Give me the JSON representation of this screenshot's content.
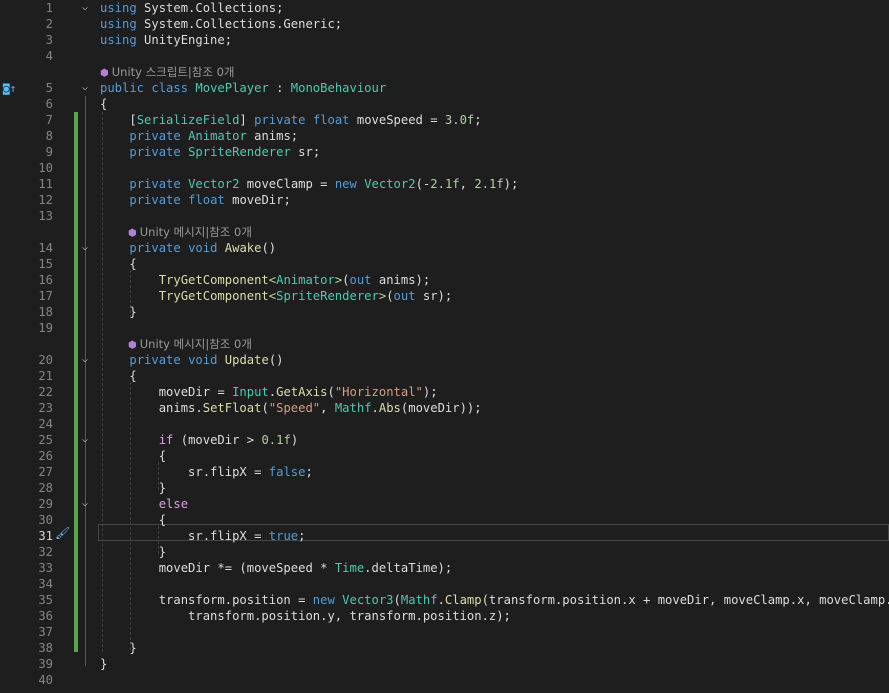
{
  "editor": {
    "lines": [
      {
        "n": "1",
        "fold": "v",
        "tokens": [
          [
            "kw",
            "using"
          ],
          [
            "pl",
            " System.Collections;"
          ]
        ]
      },
      {
        "n": "2",
        "tokens": [
          [
            "kw",
            "using"
          ],
          [
            "pl",
            " System.Collections.Generic;"
          ]
        ]
      },
      {
        "n": "3",
        "tokens": [
          [
            "kw",
            "using"
          ],
          [
            "pl",
            " UnityEngine;"
          ]
        ]
      },
      {
        "n": "4",
        "tokens": []
      },
      {
        "lens": "Unity 스크립트|참조 0개"
      },
      {
        "n": "5",
        "fold": "v",
        "tokens": [
          [
            "kw",
            "public"
          ],
          [
            "pl",
            " "
          ],
          [
            "kw",
            "class"
          ],
          [
            "pl",
            " "
          ],
          [
            "ty",
            "MovePlayer"
          ],
          [
            "pl",
            " : "
          ],
          [
            "ty",
            "MonoBehaviour"
          ]
        ]
      },
      {
        "n": "6",
        "tokens": [
          [
            "pl",
            "{"
          ]
        ]
      },
      {
        "n": "7",
        "tokens": [
          [
            "pl",
            "    ["
          ],
          [
            "ty",
            "SerializeField"
          ],
          [
            "pl",
            "] "
          ],
          [
            "kw",
            "private"
          ],
          [
            "pl",
            " "
          ],
          [
            "kw",
            "float"
          ],
          [
            "pl",
            " moveSpeed = "
          ],
          [
            "nm",
            "3.0f"
          ],
          [
            "pl",
            ";"
          ]
        ]
      },
      {
        "n": "8",
        "tokens": [
          [
            "pl",
            "    "
          ],
          [
            "kw",
            "private"
          ],
          [
            "pl",
            " "
          ],
          [
            "ty",
            "Animator"
          ],
          [
            "pl",
            " anims;"
          ]
        ]
      },
      {
        "n": "9",
        "tokens": [
          [
            "pl",
            "    "
          ],
          [
            "kw",
            "private"
          ],
          [
            "pl",
            " "
          ],
          [
            "ty",
            "SpriteRenderer"
          ],
          [
            "pl",
            " sr;"
          ]
        ]
      },
      {
        "n": "10",
        "tokens": []
      },
      {
        "n": "11",
        "tokens": [
          [
            "pl",
            "    "
          ],
          [
            "kw",
            "private"
          ],
          [
            "pl",
            " "
          ],
          [
            "ty",
            "Vector2"
          ],
          [
            "pl",
            " moveClamp = "
          ],
          [
            "kw",
            "new"
          ],
          [
            "pl",
            " "
          ],
          [
            "ty",
            "Vector2"
          ],
          [
            "pl",
            "(-"
          ],
          [
            "nm",
            "2.1f"
          ],
          [
            "pl",
            ", "
          ],
          [
            "nm",
            "2.1f"
          ],
          [
            "pl",
            ");"
          ]
        ]
      },
      {
        "n": "12",
        "tokens": [
          [
            "pl",
            "    "
          ],
          [
            "kw",
            "private"
          ],
          [
            "pl",
            " "
          ],
          [
            "kw",
            "float"
          ],
          [
            "pl",
            " moveDir;"
          ]
        ]
      },
      {
        "n": "13",
        "tokens": []
      },
      {
        "lens": "Unity 메시지|참조 0개",
        "indent": "    "
      },
      {
        "n": "14",
        "fold": "v",
        "tokens": [
          [
            "pl",
            "    "
          ],
          [
            "kw",
            "private"
          ],
          [
            "pl",
            " "
          ],
          [
            "kw",
            "void"
          ],
          [
            "pl",
            " "
          ],
          [
            "fn",
            "Awake"
          ],
          [
            "pl",
            "()"
          ]
        ]
      },
      {
        "n": "15",
        "tokens": [
          [
            "pl",
            "    {"
          ]
        ]
      },
      {
        "n": "16",
        "tokens": [
          [
            "pl",
            "        "
          ],
          [
            "fn",
            "TryGetComponent"
          ],
          [
            "gp",
            "<"
          ],
          [
            "ty",
            "Animator"
          ],
          [
            "gp",
            ">"
          ],
          [
            "pl",
            "("
          ],
          [
            "kw",
            "out"
          ],
          [
            "pl",
            " anims);"
          ]
        ]
      },
      {
        "n": "17",
        "tokens": [
          [
            "pl",
            "        "
          ],
          [
            "fn",
            "TryGetComponent"
          ],
          [
            "gp",
            "<"
          ],
          [
            "ty",
            "SpriteRenderer"
          ],
          [
            "gp",
            ">"
          ],
          [
            "pl",
            "("
          ],
          [
            "kw",
            "out"
          ],
          [
            "pl",
            " sr);"
          ]
        ]
      },
      {
        "n": "18",
        "tokens": [
          [
            "pl",
            "    }"
          ]
        ]
      },
      {
        "n": "19",
        "tokens": []
      },
      {
        "lens": "Unity 메시지|참조 0개",
        "indent": "    "
      },
      {
        "n": "20",
        "fold": "v",
        "tokens": [
          [
            "pl",
            "    "
          ],
          [
            "kw",
            "private"
          ],
          [
            "pl",
            " "
          ],
          [
            "kw",
            "void"
          ],
          [
            "pl",
            " "
          ],
          [
            "fn",
            "Update"
          ],
          [
            "pl",
            "()"
          ]
        ]
      },
      {
        "n": "21",
        "tokens": [
          [
            "pl",
            "    {"
          ]
        ]
      },
      {
        "n": "22",
        "tokens": [
          [
            "pl",
            "        moveDir = "
          ],
          [
            "ty",
            "Input"
          ],
          [
            "pl",
            "."
          ],
          [
            "fn",
            "GetAxis"
          ],
          [
            "pl",
            "("
          ],
          [
            "st",
            "\"Horizontal\""
          ],
          [
            "pl",
            ");"
          ]
        ]
      },
      {
        "n": "23",
        "tokens": [
          [
            "pl",
            "        anims."
          ],
          [
            "fn",
            "SetFloat"
          ],
          [
            "pl",
            "("
          ],
          [
            "st",
            "\"Speed\""
          ],
          [
            "pl",
            ", "
          ],
          [
            "ty",
            "Mathf"
          ],
          [
            "pl",
            "."
          ],
          [
            "fn",
            "Abs"
          ],
          [
            "pl",
            "(moveDir));"
          ]
        ]
      },
      {
        "n": "24",
        "tokens": []
      },
      {
        "n": "25",
        "fold": "v",
        "tokens": [
          [
            "pl",
            "        "
          ],
          [
            "ctl",
            "if"
          ],
          [
            "pl",
            " (moveDir > "
          ],
          [
            "nm",
            "0.1f"
          ],
          [
            "pl",
            ")"
          ]
        ]
      },
      {
        "n": "26",
        "tokens": [
          [
            "pl",
            "        {"
          ]
        ]
      },
      {
        "n": "27",
        "tokens": [
          [
            "pl",
            "            sr.flipX = "
          ],
          [
            "kw",
            "false"
          ],
          [
            "pl",
            ";"
          ]
        ]
      },
      {
        "n": "28",
        "tokens": [
          [
            "pl",
            "        }"
          ]
        ]
      },
      {
        "n": "29",
        "fold": "v",
        "tokens": [
          [
            "pl",
            "        "
          ],
          [
            "ctl",
            "else"
          ]
        ]
      },
      {
        "n": "30",
        "tokens": [
          [
            "pl",
            "        {"
          ]
        ]
      },
      {
        "n": "31",
        "active": true,
        "tokens": [
          [
            "pl",
            "            sr.flipX = "
          ],
          [
            "kw",
            "true"
          ],
          [
            "pl",
            ";"
          ]
        ]
      },
      {
        "n": "32",
        "tokens": [
          [
            "pl",
            "        }"
          ]
        ]
      },
      {
        "n": "33",
        "tokens": [
          [
            "pl",
            "        moveDir *= (moveSpeed * "
          ],
          [
            "ty",
            "Time"
          ],
          [
            "pl",
            ".deltaTime);"
          ]
        ]
      },
      {
        "n": "34",
        "tokens": []
      },
      {
        "n": "35",
        "tokens": [
          [
            "pl",
            "        transform.position = "
          ],
          [
            "kw",
            "new"
          ],
          [
            "pl",
            " "
          ],
          [
            "ty",
            "Vector3"
          ],
          [
            "pl",
            "("
          ],
          [
            "ty",
            "Mathf"
          ],
          [
            "pl",
            "."
          ],
          [
            "fn",
            "Clamp"
          ],
          [
            "pl",
            "(transform.position.x + moveDir, moveClamp.x, moveClamp.y),"
          ]
        ]
      },
      {
        "n": "36",
        "tokens": [
          [
            "pl",
            "            transform.position.y, transform.position.z);"
          ]
        ]
      },
      {
        "n": "37",
        "tokens": []
      },
      {
        "n": "38",
        "tokens": [
          [
            "pl",
            "    }"
          ]
        ]
      },
      {
        "n": "39",
        "tokens": [
          [
            "pl",
            "}"
          ]
        ]
      },
      {
        "n": "40",
        "tokens": []
      }
    ]
  },
  "icons": {
    "gutter": "bookmark-up-icon",
    "brush": "quick-actions-brush-icon"
  },
  "colors": {
    "background": "#1e1e1e",
    "keyword": "#569cd6",
    "type": "#4ec9b0",
    "method": "#dcdcaa",
    "string": "#d69d85",
    "number": "#b5cea8",
    "control": "#d8a0df",
    "change_bar": "#57a64a"
  }
}
